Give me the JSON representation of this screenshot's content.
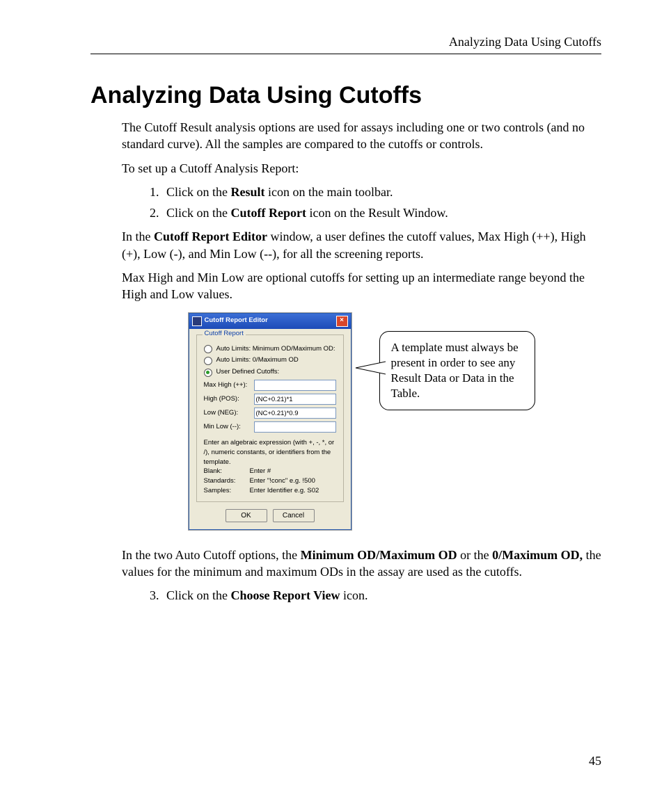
{
  "header": {
    "running": "Analyzing Data Using Cutoffs"
  },
  "h1": "Analyzing Data Using Cutoffs",
  "p_intro": "The Cutoff Result analysis options are used for assays including one or two controls (and no standard curve).  All the samples are compared to the cutoffs or controls.",
  "p_setup": "To set up a Cutoff Analysis Report:",
  "steps12": {
    "s1a": "Click on the ",
    "s1b": "Result",
    "s1c": " icon on the main toolbar.",
    "s2a": "Click on the ",
    "s2b": "Cutoff Report",
    "s2c": " icon on the Result Window."
  },
  "p_editor_a": "In the ",
  "p_editor_b": "Cutoff Report Editor",
  "p_editor_c": " window, a user defines the cutoff values, Max High (++), High (+), Low (-), and Min Low (--), for all the screening reports.",
  "p_maxmin": "Max High and Min Low are optional cutoffs for setting up an intermediate range beyond the High and Low values.",
  "dlg": {
    "title": "Cutoff Report Editor",
    "legend": "Cutoff Report",
    "opt1": "Auto Limits: Minimum OD/Maximum OD:",
    "opt2": "Auto Limits: 0/Maximum OD",
    "opt3": "User Defined Cutoffs:",
    "f_maxhigh": "Max High (++):",
    "f_high": "High (POS):",
    "f_low": "Low (NEG):",
    "f_minlow": "Min Low (--):",
    "v_high": "(NC+0.21)*1",
    "v_low": "(NC+0.21)*0.9",
    "hint_top": "Enter an algebraic expression (with +, -, *, or /), numeric constants, or identifiers from the template.",
    "hint_blank_k": "Blank:",
    "hint_blank_v": "Enter #",
    "hint_std_k": "Standards:",
    "hint_std_v": "Enter \"!conc\"  e.g. !500",
    "hint_smp_k": "Samples:",
    "hint_smp_v": "Enter Identifier  e.g. S02",
    "ok": "OK",
    "cancel": "Cancel"
  },
  "callout": "A template must always be present in order to see any Result Data or Data in the Table.",
  "p_auto_a": "In the two Auto Cutoff options, the ",
  "p_auto_b": "Minimum OD/Maximum OD",
  "p_auto_c": " or the ",
  "p_auto_d": "0/Maximum OD,",
  "p_auto_e": " the values for the minimum and maximum ODs in the assay are used as the cutoffs.",
  "step3a": "Click on the ",
  "step3b": "Choose Report View",
  "step3c": " icon.",
  "pagenum": "45"
}
